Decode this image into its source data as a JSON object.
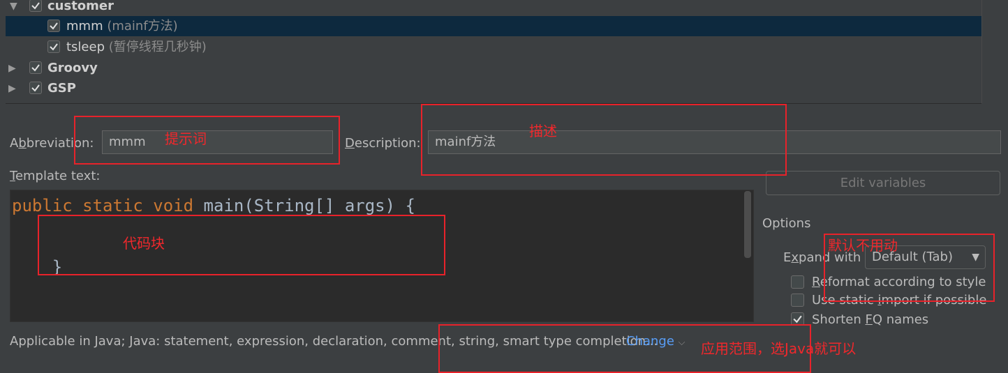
{
  "tree": {
    "items": [
      {
        "label": "customer",
        "desc": "",
        "expanded": true
      },
      {
        "label": "mmm",
        "desc": "(mainf方法)"
      },
      {
        "label": "tsleep",
        "desc": "(暂停线程几秒钟)"
      },
      {
        "label": "Groovy",
        "desc": ""
      },
      {
        "label": "GSP",
        "desc": ""
      }
    ]
  },
  "form": {
    "abbreviation_label": "Abbreviation:",
    "abbreviation_value": "mmm",
    "description_label": "Description:",
    "description_value": "mainf方法",
    "template_label": "Template text:",
    "code_line1_kw": "public static void",
    "code_line1_rest": " main(String[] args) {",
    "code_line3": "    }",
    "edit_variables": "Edit variables",
    "options_title": "Options",
    "expand_with_label": "Expand with",
    "expand_with_value": "Default (Tab)",
    "opt_reformat": "Reformat according to style",
    "opt_static_import": "Use static import if possible",
    "opt_shorten": "Shorten FQ names",
    "applicable_text": "Applicable in Java; Java: statement, expression, declaration, comment, string, smart type completion...",
    "change_link": "Change"
  },
  "annotations": {
    "abbreviation_note": "提示词",
    "description_note": "描述",
    "code_note": "代码块",
    "expand_note": "默认不用动",
    "scope_note": "应用范围，选Java就可以"
  },
  "colors": {
    "background": "#3c3f41",
    "selection": "#0d293e",
    "keyword": "#cc7832",
    "annotation_red": "#e8222a",
    "link": "#589df6"
  }
}
